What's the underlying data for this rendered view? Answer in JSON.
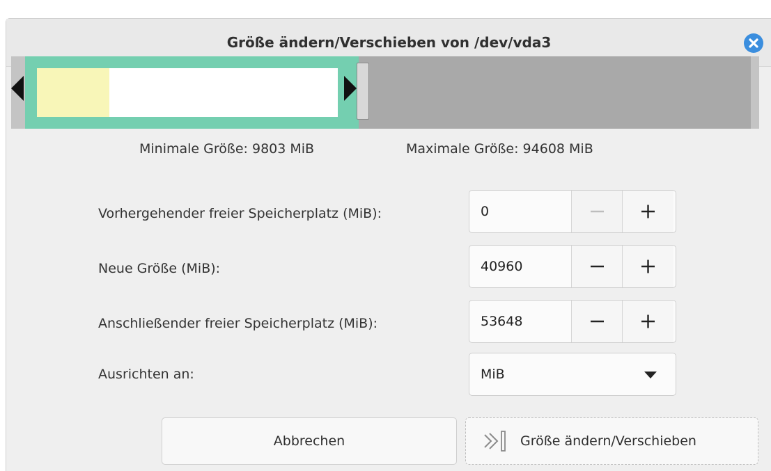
{
  "dialog": {
    "title": "Größe ändern/Verschieben von /dev/vda3",
    "close_icon": "close-icon"
  },
  "partition_map": {
    "used_fraction": 0.24,
    "colors": {
      "partition_border": "#74cfb0",
      "used": "#f8f6b8",
      "unallocated": "#a9a9a9"
    }
  },
  "limits": {
    "min_label": "Minimale Größe: 9803 MiB",
    "max_label": "Maximale Größe: 94608 MiB"
  },
  "fields": {
    "free_before": {
      "label": "Vorhergehender freier Speicherplatz (MiB):",
      "value": "0",
      "minus_enabled": false
    },
    "new_size": {
      "label": "Neue Größe (MiB):",
      "value": "40960",
      "minus_enabled": true
    },
    "free_after": {
      "label": "Anschließender freier Speicherplatz (MiB):",
      "value": "53648",
      "minus_enabled": true
    },
    "align": {
      "label": "Ausrichten an:",
      "selected": "MiB"
    }
  },
  "buttons": {
    "cancel": "Abbrechen",
    "apply": "Größe ändern/Verschieben"
  },
  "accent": "#3b8ede"
}
